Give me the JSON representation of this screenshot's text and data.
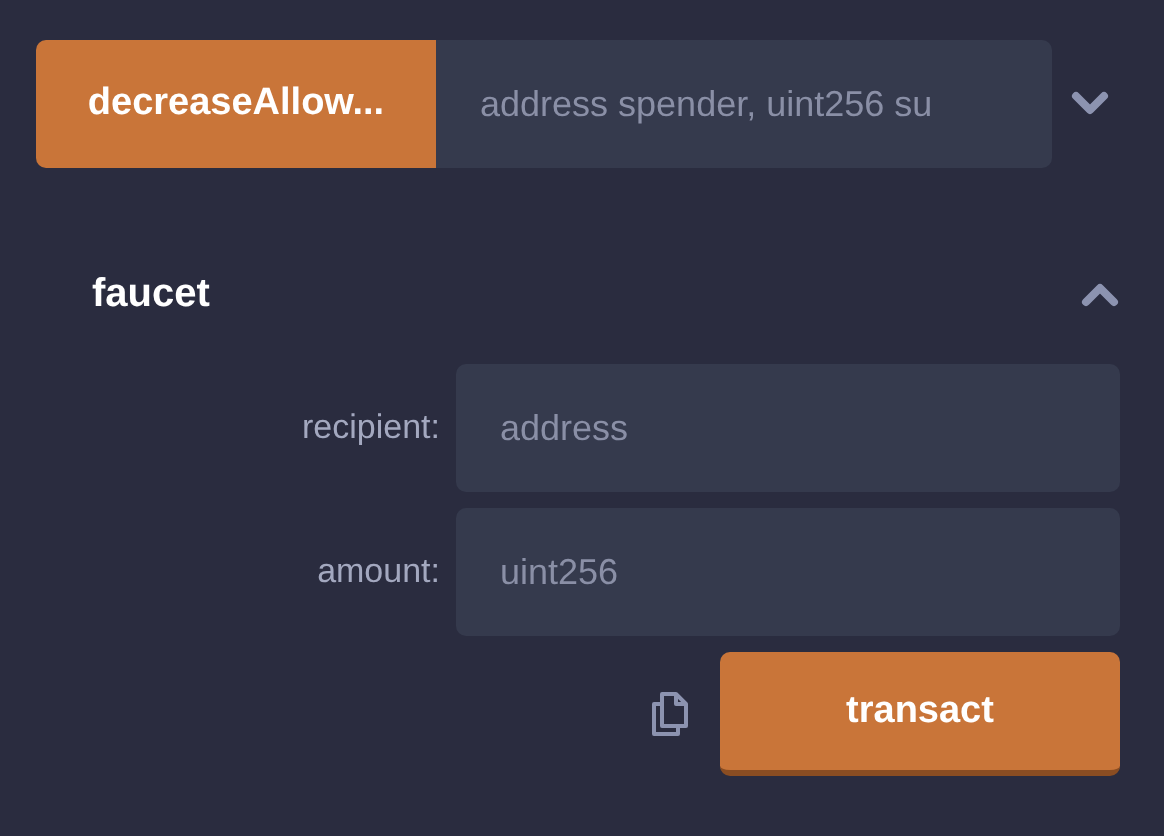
{
  "functions": [
    {
      "name": "decreaseAllow...",
      "expanded": false,
      "placeholder": "address spender, uint256 su"
    },
    {
      "name": "faucet",
      "expanded": true,
      "inputs": [
        {
          "label": "recipient:",
          "placeholder": "address"
        },
        {
          "label": "amount:",
          "placeholder": "uint256"
        }
      ],
      "button": "transact"
    }
  ]
}
